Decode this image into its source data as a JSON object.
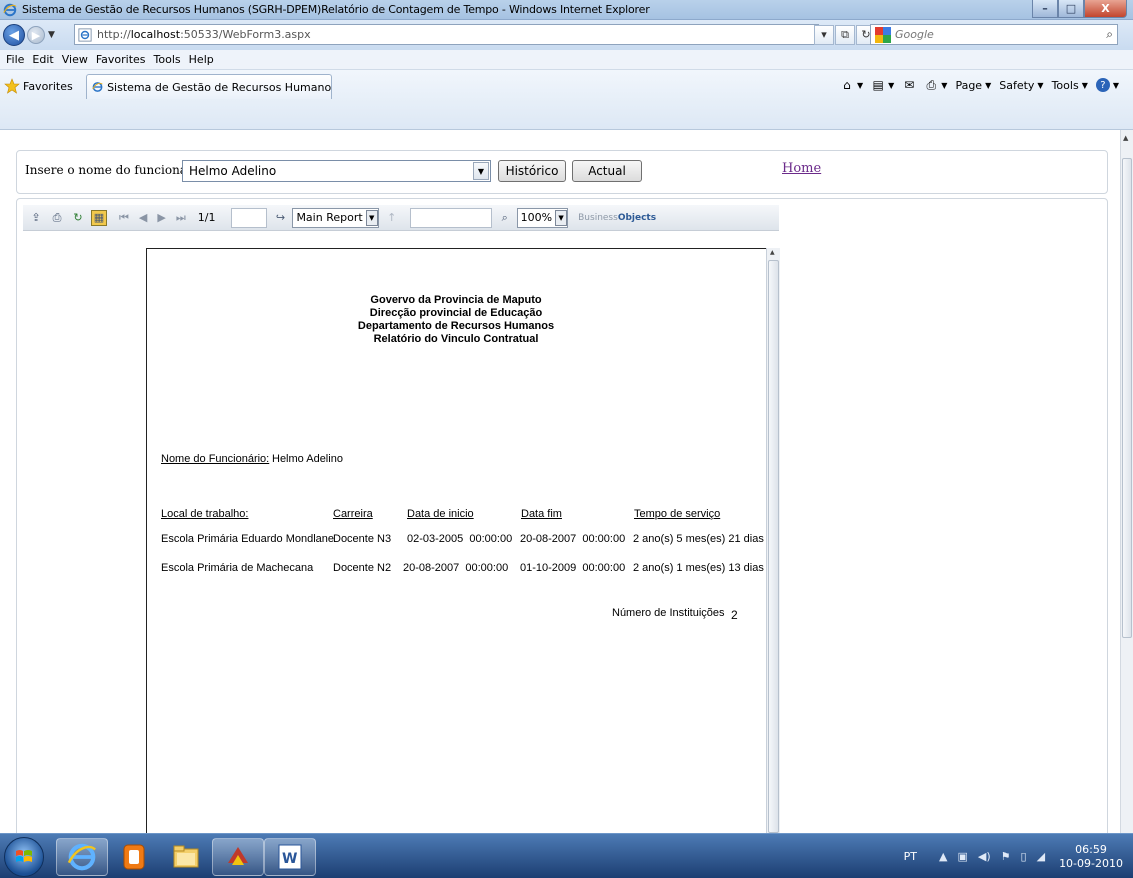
{
  "window": {
    "title": "Sistema de Gestão de Recursos Humanos (SGRH-DPEM)Relatório de Contagem de Tempo - Windows Internet Explorer",
    "min_label": "–",
    "max_label": "□",
    "close_label": "X"
  },
  "address": {
    "url_prefix": "http://",
    "url_host": "localhost",
    "url_rest": ":50533/WebForm3.aspx"
  },
  "search": {
    "placeholder": "Google"
  },
  "menu": [
    "File",
    "Edit",
    "View",
    "Favorites",
    "Tools",
    "Help"
  ],
  "favorites": {
    "label": "Favorites",
    "tab_label": "Sistema de Gestão de Recursos Humanos (SGRH-...",
    "commands": [
      "Page",
      "Safety",
      "Tools"
    ]
  },
  "form": {
    "label": "Insere o nome do funcionário :",
    "selected_employee": "Helmo Adelino",
    "historico_label": "Histórico",
    "actual_label": "Actual",
    "home_link": "Home"
  },
  "viewer": {
    "page_indicator": "1/1",
    "report_select": "Main Report",
    "zoom": "100%",
    "brand_prefix": "Business",
    "brand_suffix": "Objects"
  },
  "report": {
    "header_lines": [
      "Govervo da Provincia de Maputo",
      "Direcção provincial de Educação",
      "Departamento de Recursos Humanos",
      "Relatório do Vinculo Contratual"
    ],
    "employee_label": "Nome do Funcionário:",
    "employee_name": "Helmo Adelino",
    "columns": [
      "Local de trabalho:",
      "Carreira",
      "Data de inicio",
      "Data fim",
      "Tempo de serviço"
    ],
    "rows": [
      [
        "Escola Primária Eduardo Mondlane",
        "Docente N3",
        "02-03-2005  00:00:00",
        "20-08-2007  00:00:00",
        "2 ano(s) 5 mes(es) 21 dias"
      ],
      [
        "Escola Primária de Machecana",
        "Docente N2",
        "20-08-2007  00:00:00",
        "01-10-2009  00:00:00",
        "2 ano(s) 1 mes(es) 13 dias"
      ]
    ],
    "institutions_label": "Número de Instituições",
    "institutions_count": "2"
  },
  "taskbar": {
    "language": "PT",
    "time": "06:59",
    "date": "10-09-2010"
  },
  "colors": {
    "link_visited": "#6b2a8a",
    "titlebar": "#b9d1ea",
    "taskbar": "#1c3e72"
  }
}
